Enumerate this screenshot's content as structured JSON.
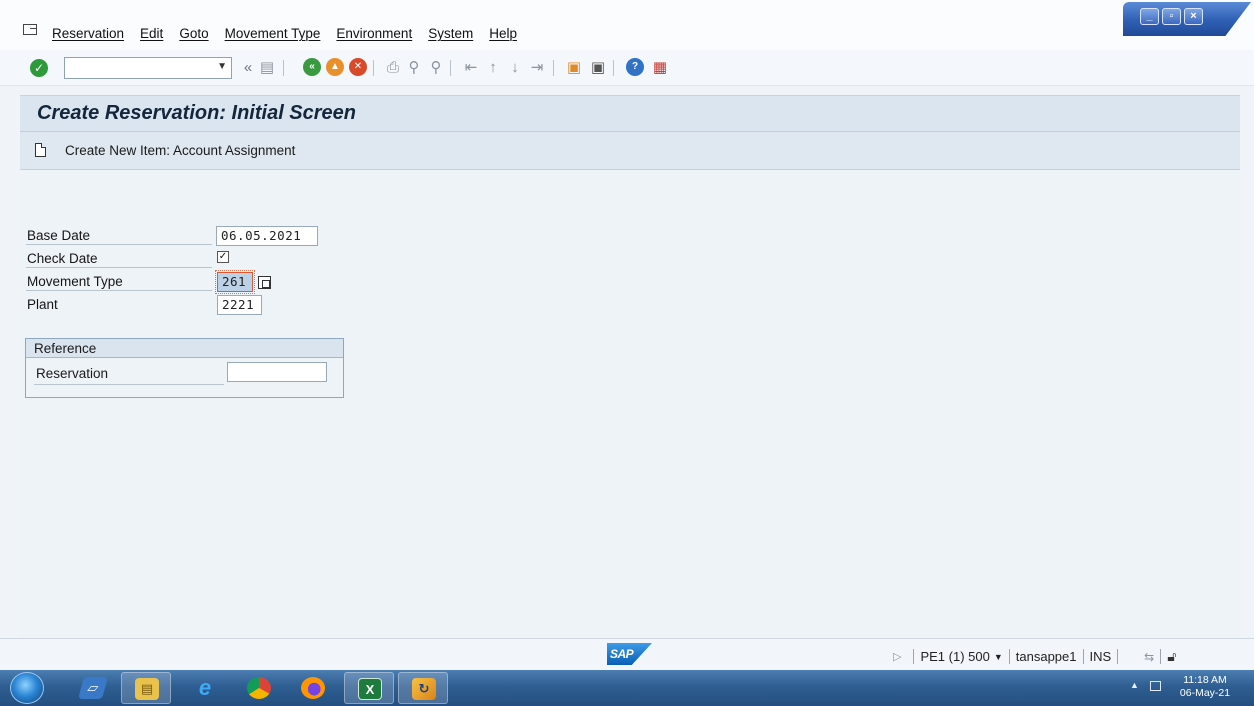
{
  "menubar": {
    "items": [
      "Reservation",
      "Edit",
      "Goto",
      "Movement Type",
      "Environment",
      "System",
      "Help"
    ]
  },
  "window_controls": {
    "minimize": "_",
    "restore": "▫",
    "close": "×"
  },
  "toolbar": {
    "command_field_value": "",
    "icons": [
      "enter-icon",
      "save-icon",
      "back-icon",
      "exit-icon",
      "cancel-icon",
      "print-icon",
      "find-icon",
      "find-next-icon",
      "first-page-icon",
      "previous-page-icon",
      "next-page-icon",
      "last-page-icon",
      "create-session-icon",
      "shortcut-icon",
      "help-icon",
      "customize-layout-icon"
    ]
  },
  "title": "Create Reservation: Initial Screen",
  "app_toolbar": {
    "button_label": "Create New Item: Account Assignment"
  },
  "form": {
    "base_date_label": "Base Date",
    "base_date_value": "06.05.2021",
    "check_date_label": "Check Date",
    "check_date_checked": true,
    "movement_type_label": "Movement Type",
    "movement_type_value": "261",
    "plant_label": "Plant",
    "plant_value": "2221"
  },
  "reference": {
    "header": "Reference",
    "reservation_label": "Reservation",
    "reservation_value": ""
  },
  "statusbar": {
    "logo": "SAP",
    "system": "PE1 (1) 500",
    "server": "tansappe1",
    "mode": "INS"
  },
  "taskbar": {
    "apps": [
      "start-icon",
      "windows-explorer-icon",
      "file-manager-icon",
      "internet-explorer-icon",
      "chrome-icon",
      "firefox-icon",
      "excel-icon",
      "sap-logon-icon"
    ],
    "clock_time": "11:18 AM",
    "clock_date": "06-May-21"
  }
}
